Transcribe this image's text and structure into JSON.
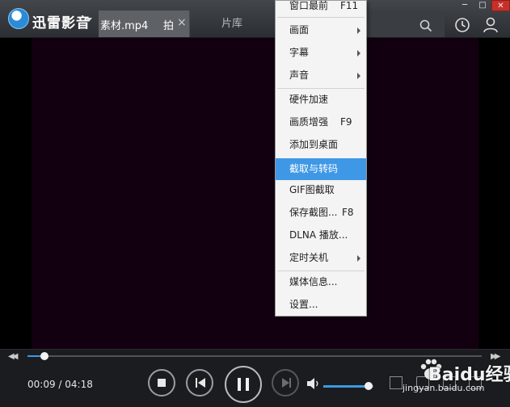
{
  "app": {
    "brand": "迅雷影音"
  },
  "tabs": {
    "active_name": "素材.mp4",
    "active_next": "拍",
    "close": "×",
    "library": "片库"
  },
  "window": {
    "minimize": "─",
    "maximize": "□",
    "close": "✕"
  },
  "player": {
    "time": "00:09 / 04:18",
    "progress": 0.037,
    "volume": 0.9,
    "seek_back": "◀◀",
    "seek_forward": "▶▶"
  },
  "menu": {
    "items": [
      {
        "label": "窗口最前",
        "shortcut": "F11",
        "submenu": false,
        "highlighted": false
      },
      {
        "label": "画面",
        "shortcut": "",
        "submenu": true,
        "highlighted": false
      },
      {
        "label": "字幕",
        "shortcut": "",
        "submenu": true,
        "highlighted": false
      },
      {
        "label": "声音",
        "shortcut": "",
        "submenu": true,
        "highlighted": false
      },
      {
        "label": "硬件加速",
        "shortcut": "",
        "submenu": false,
        "highlighted": false
      },
      {
        "label": "画质增强",
        "shortcut": "F9",
        "submenu": false,
        "highlighted": false
      },
      {
        "label": "添加到桌面",
        "shortcut": "",
        "submenu": false,
        "highlighted": false
      },
      {
        "label": "截取与转码",
        "shortcut": "",
        "submenu": false,
        "highlighted": true
      },
      {
        "label": "GIF图截取",
        "shortcut": "",
        "submenu": false,
        "highlighted": false
      },
      {
        "label": "保存截图...",
        "shortcut": "F8",
        "submenu": false,
        "highlighted": false
      },
      {
        "label": "DLNA 播放...",
        "shortcut": "",
        "submenu": false,
        "highlighted": false
      },
      {
        "label": "定时关机",
        "shortcut": "",
        "submenu": true,
        "highlighted": false
      },
      {
        "label": "媒体信息...",
        "shortcut": "",
        "submenu": false,
        "highlighted": false
      },
      {
        "label": "设置...",
        "shortcut": "",
        "submenu": false,
        "highlighted": false
      }
    ]
  },
  "watermark": {
    "text": "Baidu经验",
    "sub": "jingyan.baidu.com"
  },
  "colors": {
    "accent": "#3b9ae1",
    "menu_highlight": "#3f98e6",
    "video_bg": "#120011",
    "close_red": "#c7302a"
  }
}
